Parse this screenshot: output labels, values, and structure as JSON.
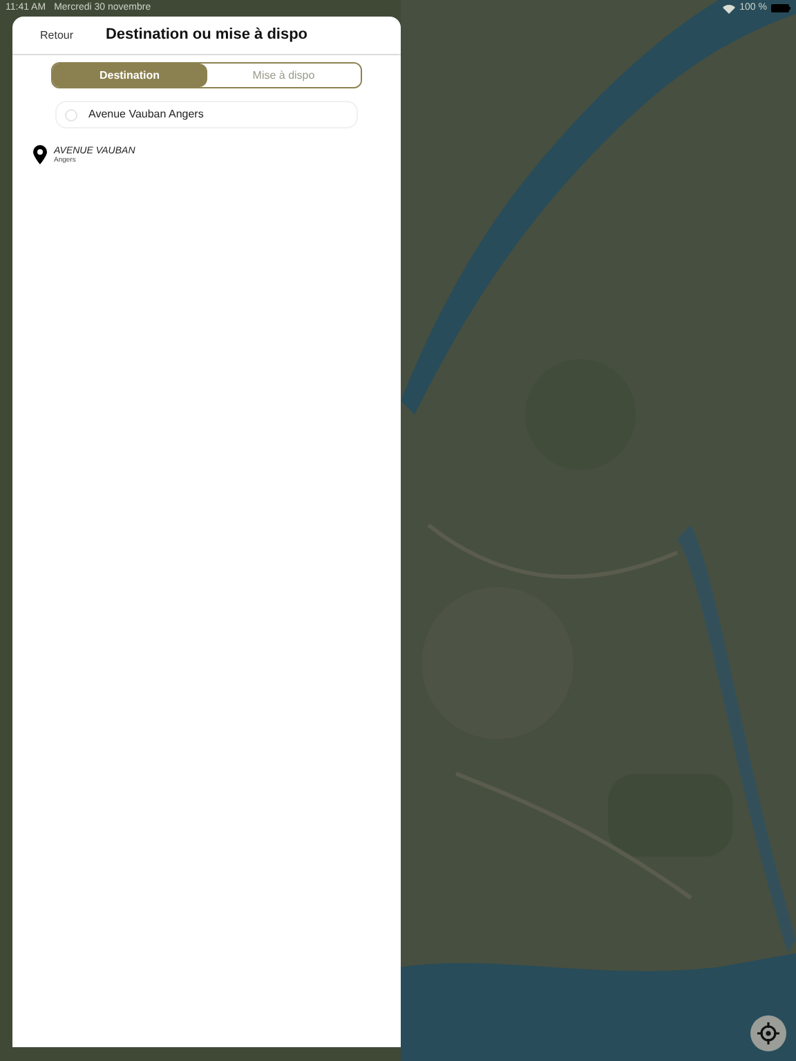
{
  "status_bar": {
    "time": "11:41 AM",
    "date": "Mercredi 30 novembre",
    "battery_text": "100 %"
  },
  "panel": {
    "back": "Retour",
    "title": "Destination ou mise à dispo",
    "tabs": [
      {
        "label": "Destination",
        "selected": true
      },
      {
        "label": "Mise à dispo",
        "selected": false
      }
    ],
    "search": {
      "value": "Avenue Vauban Angers"
    },
    "results": [
      {
        "name": "AVENUE VAUBAN",
        "city": "Angers"
      }
    ]
  }
}
